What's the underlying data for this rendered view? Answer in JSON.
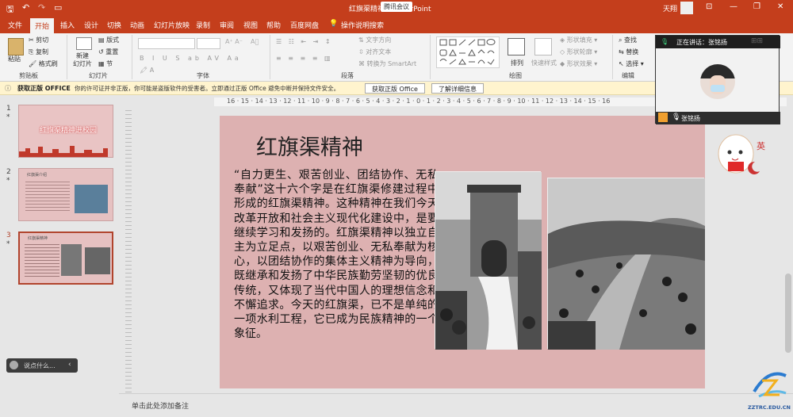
{
  "titlebar": {
    "title": "红旗渠精神 - PowerPoint",
    "meeting": "腾讯会议",
    "user": "天翔",
    "brand_color": "#c43e1c"
  },
  "tabs": [
    "文件",
    "开始",
    "插入",
    "设计",
    "切换",
    "动画",
    "幻灯片放映",
    "录制",
    "审阅",
    "视图",
    "帮助",
    "百度网盘"
  ],
  "tell_me": "操作说明搜索",
  "ribbon": {
    "clipboard": {
      "paste": "粘贴",
      "cut": "剪切",
      "copy": "复制",
      "format_painter": "格式刷",
      "group": "剪贴板"
    },
    "slides": {
      "new_slide": "新建\n幻灯片",
      "layout": "版式",
      "reset": "重置",
      "section": "节",
      "group": "幻灯片"
    },
    "font": {
      "group": "字体"
    },
    "paragraph": {
      "text_direction": "文字方向",
      "align_text": "对齐文本",
      "smartart": "转换为 SmartArt",
      "group": "段落"
    },
    "drawing": {
      "arrange": "排列",
      "quick_styles": "快速样式",
      "fill": "形状填充",
      "outline": "形状轮廓",
      "effects": "形状效果",
      "group": "绘图"
    },
    "editing": {
      "find": "查找",
      "replace": "替换",
      "select": "选择",
      "group": "编辑"
    }
  },
  "notice": {
    "title": "获取正版 OFFICE",
    "text": "你的许可证并非正版，你可能是盗版软件的受害者。立即通过正版 Office 避免中断并保持文件安全。",
    "btn1": "获取正版 Office",
    "btn2": "了解详细信息"
  },
  "ruler": "16 · 15 · 14 · 13 · 12 · 11 · 10 · 9 · 8 · 7 · 6 · 5 · 4 · 3 · 2 · 1 · 0 · 1 · 2 · 3 · 4 · 5 · 6 · 7 · 8 · 9 · 10 · 11 · 12 · 13 · 14 · 15 · 16",
  "thumbnails": [
    {
      "num": "1",
      "star": "*",
      "label": "红旗渠精神进校园"
    },
    {
      "num": "2",
      "star": "*",
      "label": "红旗渠介绍"
    },
    {
      "num": "3",
      "star": "*",
      "label": "红旗渠精神"
    }
  ],
  "slide": {
    "title": "红旗渠精神",
    "body": "“自力更生、艰苦创业、团结协作、无私奉献”这十六个字是在红旗渠修建过程中形成的红旗渠精神。这种精神在我们今天改革开放和社会主义现代化建设中，是要继续学习和发扬的。红旗渠精神以独立自主为立足点，以艰苦创业、无私奉献为核心，以团结协作的集体主义精神为导向，既继承和发扬了中华民族勤劳坚韧的优良传统，又体现了当代中国人的理想信念和不懈追求。今天的红旗渠，已不是单纯的一项水利工程，它已成为民族精神的一个象征。",
    "bg": "#ddb1b1"
  },
  "notes_placeholder": "单击此处添加备注",
  "video": {
    "speaking": "正在讲话：张铭扬",
    "name": "张铭扬"
  },
  "chat": {
    "placeholder": "说点什么..."
  },
  "mascot_text": "英",
  "watermark": "ZZTRC.EDU.CN"
}
